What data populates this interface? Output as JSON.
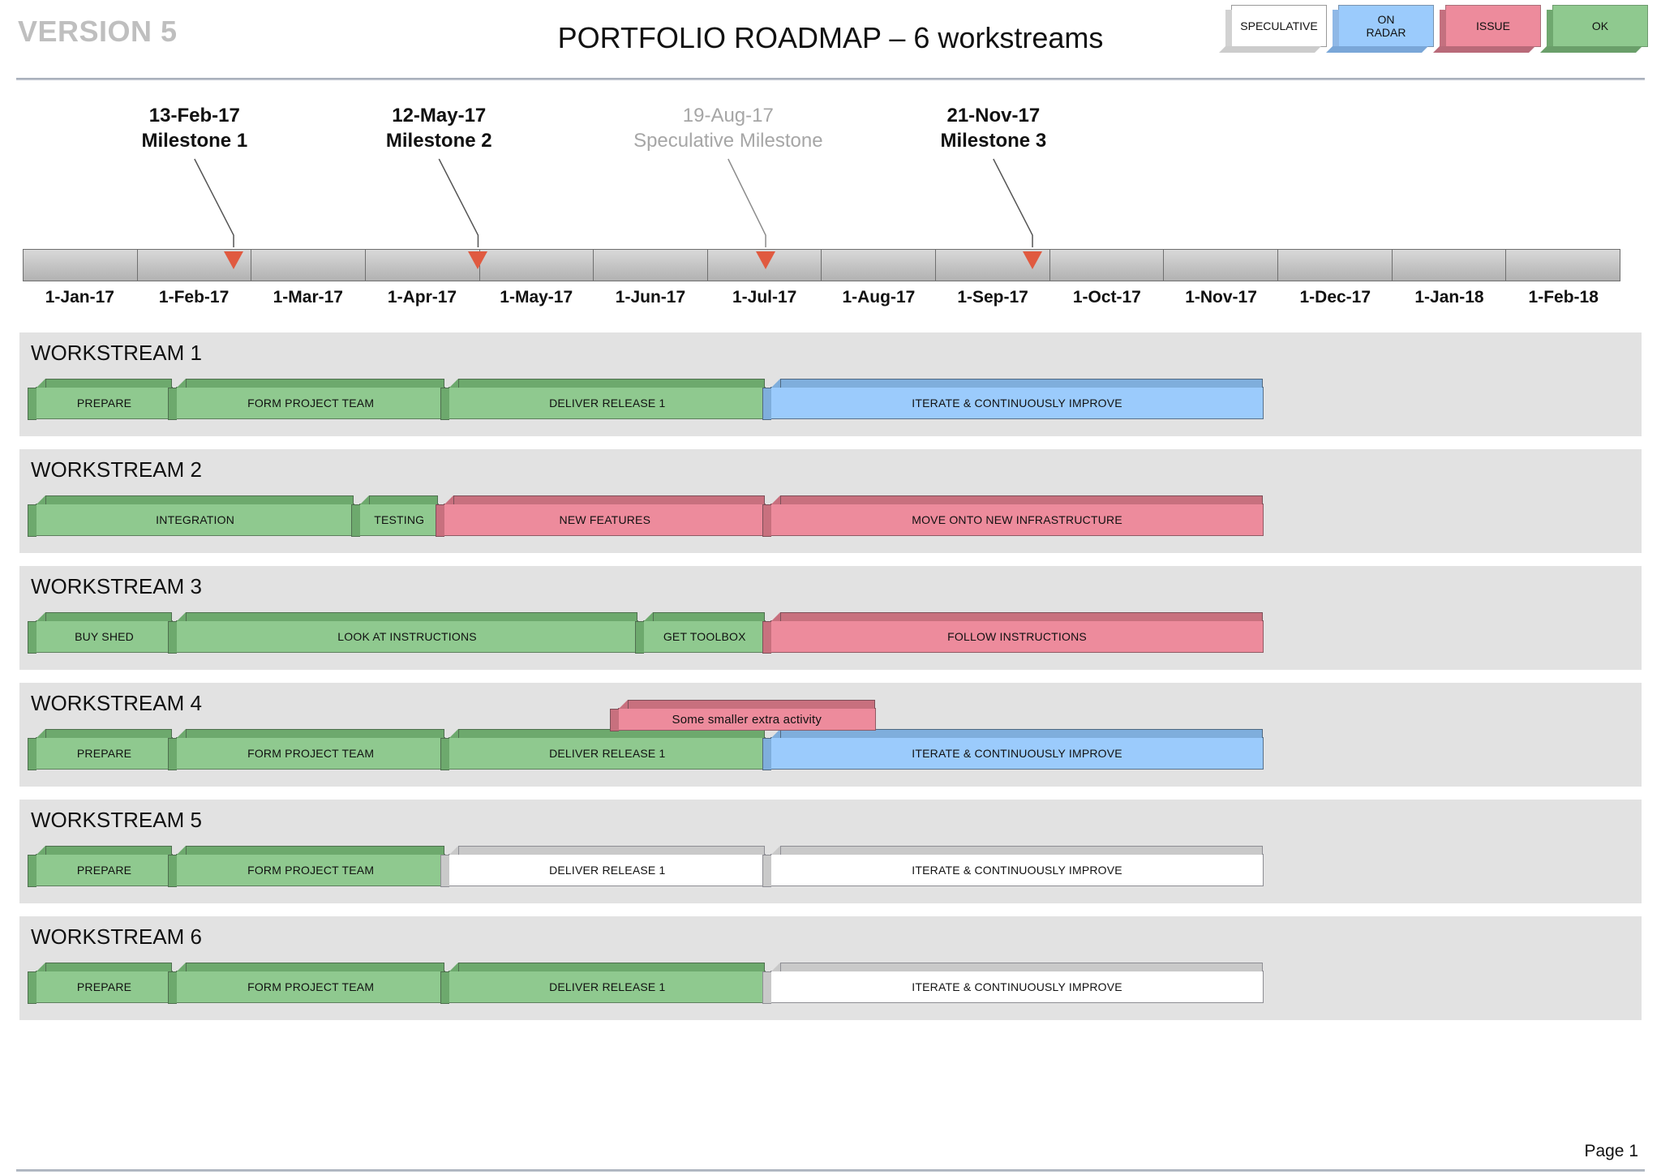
{
  "header": {
    "version": "VERSION 5",
    "title": "PORTFOLIO ROADMAP – 6 workstreams",
    "legend": [
      {
        "label": "SPECULATIVE",
        "style": "speculative",
        "color": "#FFFFFF"
      },
      {
        "label": "ON\nRADAR",
        "line1": "ON",
        "line2": "RADAR",
        "style": "on-radar",
        "color": "#9BCBFC"
      },
      {
        "label": "ISSUE",
        "style": "issue",
        "color": "#ED8B9C"
      },
      {
        "label": "OK",
        "style": "ok",
        "color": "#8FC98F"
      }
    ]
  },
  "milestones": [
    {
      "date": "13-Feb-17",
      "name": "Milestone 1",
      "speculative": false,
      "label_left_pct": 7.2,
      "arrow_pct": 13.2
    },
    {
      "date": "12-May-17",
      "name": "Milestone 2",
      "speculative": false,
      "label_left_pct": 22.5,
      "arrow_pct": 28.5
    },
    {
      "date": "19-Aug-17",
      "name": "Speculative Milestone",
      "speculative": true,
      "label_left_pct": 40.6,
      "arrow_pct": 46.5
    },
    {
      "date": "21-Nov-17",
      "name": "Milestone 3",
      "speculative": false,
      "label_left_pct": 57.2,
      "arrow_pct": 63.2
    }
  ],
  "timeline": {
    "ticks": [
      "1-Jan-17",
      "1-Feb-17",
      "1-Mar-17",
      "1-Apr-17",
      "1-May-17",
      "1-Jun-17",
      "1-Jul-17",
      "1-Aug-17",
      "1-Sep-17",
      "1-Oct-17",
      "1-Nov-17",
      "1-Dec-17",
      "1-Jan-18",
      "1-Feb-18"
    ]
  },
  "workstreams": [
    {
      "title": "WORKSTREAM 1",
      "bars": [
        {
          "label": "PREPARE",
          "status": "ok",
          "left_pct": 0.0,
          "width_pct": 8.6
        },
        {
          "label": "FORM PROJECT TEAM",
          "status": "ok",
          "left_pct": 8.8,
          "width_pct": 16.9
        },
        {
          "label": "DELIVER RELEASE 1",
          "status": "ok",
          "left_pct": 25.9,
          "width_pct": 19.9
        },
        {
          "label": "ITERATE & CONTINUOUSLY IMPROVE",
          "status": "on-radar",
          "left_pct": 46.1,
          "width_pct": 30.9
        }
      ]
    },
    {
      "title": "WORKSTREAM 2",
      "bars": [
        {
          "label": "INTEGRATION",
          "status": "ok",
          "left_pct": 0.0,
          "width_pct": 20.0
        },
        {
          "label": "TESTING",
          "status": "ok",
          "left_pct": 20.3,
          "width_pct": 5.0
        },
        {
          "label": "NEW FEATURES",
          "status": "issue",
          "left_pct": 25.6,
          "width_pct": 20.2
        },
        {
          "label": "MOVE ONTO NEW INFRASTRUCTURE",
          "status": "issue",
          "left_pct": 46.1,
          "width_pct": 30.9
        }
      ]
    },
    {
      "title": "WORKSTREAM 3",
      "bars": [
        {
          "label": "BUY SHED",
          "status": "ok",
          "left_pct": 0.0,
          "width_pct": 8.6
        },
        {
          "label": "LOOK AT INSTRUCTIONS",
          "status": "ok",
          "left_pct": 8.8,
          "width_pct": 29.0
        },
        {
          "label": "GET TOOLBOX",
          "status": "ok",
          "left_pct": 38.1,
          "width_pct": 7.7
        },
        {
          "label": "FOLLOW INSTRUCTIONS",
          "status": "issue",
          "left_pct": 46.1,
          "width_pct": 30.9
        }
      ]
    },
    {
      "title": "WORKSTREAM 4",
      "extra_bar": {
        "label": "Some smaller extra activity",
        "status": "issue",
        "left_pct": 36.5,
        "width_pct": 16.2
      },
      "bars": [
        {
          "label": "PREPARE",
          "status": "ok",
          "left_pct": 0.0,
          "width_pct": 8.6
        },
        {
          "label": "FORM PROJECT TEAM",
          "status": "ok",
          "left_pct": 8.8,
          "width_pct": 16.9
        },
        {
          "label": "DELIVER RELEASE 1",
          "status": "ok",
          "left_pct": 25.9,
          "width_pct": 19.9
        },
        {
          "label": "ITERATE & CONTINUOUSLY IMPROVE",
          "status": "on-radar",
          "left_pct": 46.1,
          "width_pct": 30.9
        }
      ]
    },
    {
      "title": "WORKSTREAM 5",
      "bars": [
        {
          "label": "PREPARE",
          "status": "ok",
          "left_pct": 0.0,
          "width_pct": 8.6
        },
        {
          "label": "FORM PROJECT TEAM",
          "status": "ok",
          "left_pct": 8.8,
          "width_pct": 16.9
        },
        {
          "label": "DELIVER RELEASE 1",
          "status": "speculative",
          "left_pct": 25.9,
          "width_pct": 19.9
        },
        {
          "label": "ITERATE & CONTINUOUSLY IMPROVE",
          "status": "speculative",
          "left_pct": 46.1,
          "width_pct": 30.9
        }
      ]
    },
    {
      "title": "WORKSTREAM 6",
      "bars": [
        {
          "label": "PREPARE",
          "status": "ok",
          "left_pct": 0.0,
          "width_pct": 8.6
        },
        {
          "label": "FORM PROJECT TEAM",
          "status": "ok",
          "left_pct": 8.8,
          "width_pct": 16.9
        },
        {
          "label": "DELIVER RELEASE 1",
          "status": "ok",
          "left_pct": 25.9,
          "width_pct": 19.9
        },
        {
          "label": "ITERATE & CONTINUOUSLY IMPROVE",
          "status": "speculative",
          "left_pct": 46.1,
          "width_pct": 30.9
        }
      ]
    }
  ],
  "footer": {
    "page": "Page 1"
  },
  "colors": {
    "ok": "#8FC98F",
    "issue": "#ED8B9C",
    "on_radar": "#9BCBFC",
    "speculative": "#FFFFFF",
    "row_background": "#E2E2E2",
    "milestone_arrow": "#E05A40",
    "version_text": "#BFBFBF"
  }
}
